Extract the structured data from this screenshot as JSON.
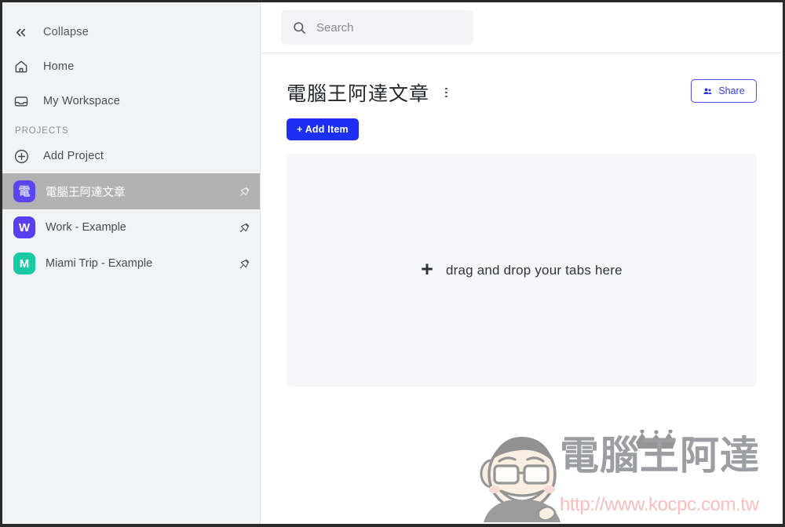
{
  "sidebar": {
    "collapse": {
      "label": "Collapse",
      "icon": "chevron-double-left-icon"
    },
    "nav": [
      {
        "label": "Home",
        "icon": "home-icon"
      },
      {
        "label": "My Workspace",
        "icon": "inbox-icon"
      }
    ],
    "section_label": "PROJECTS",
    "add_project": {
      "label": "Add Project",
      "icon": "plus-circle-icon"
    },
    "projects": [
      {
        "label": "電腦王阿達文章",
        "avatar_text": "電",
        "avatar_color": "#5a46f0",
        "active": true,
        "pinned": true
      },
      {
        "label": "Work - Example",
        "avatar_text": "W",
        "avatar_color": "#5a3ff0",
        "active": false,
        "pinned": true
      },
      {
        "label": "Miami Trip - Example",
        "avatar_text": "M",
        "avatar_color": "#19c9a6",
        "active": false,
        "pinned": true
      }
    ]
  },
  "search": {
    "placeholder": "Search",
    "value": "",
    "icon": "search-icon"
  },
  "main": {
    "page_title": "電腦王阿達文章",
    "kebab_icon": "more-vertical-icon",
    "share": {
      "label": "Share",
      "icon": "people-icon"
    },
    "add_item": {
      "label": "+ Add Item"
    },
    "dropzone": {
      "plus": "+",
      "text": "drag and drop your tabs here"
    }
  },
  "watermark": {
    "brand_cjk": "電腦王阿達",
    "url": "http://www.kocpc.com.tw",
    "face_icon": "cartoon-face-icon",
    "crown_icon": "crown-icon"
  },
  "colors": {
    "accent_blue": "#1c2ff2",
    "share_border": "#4b4fe8",
    "sidebar_bg": "#f2f3f5",
    "active_row": "#b2b2b2",
    "dropzone_bg": "#f7f7f9",
    "watermark_url": "#f08080"
  }
}
